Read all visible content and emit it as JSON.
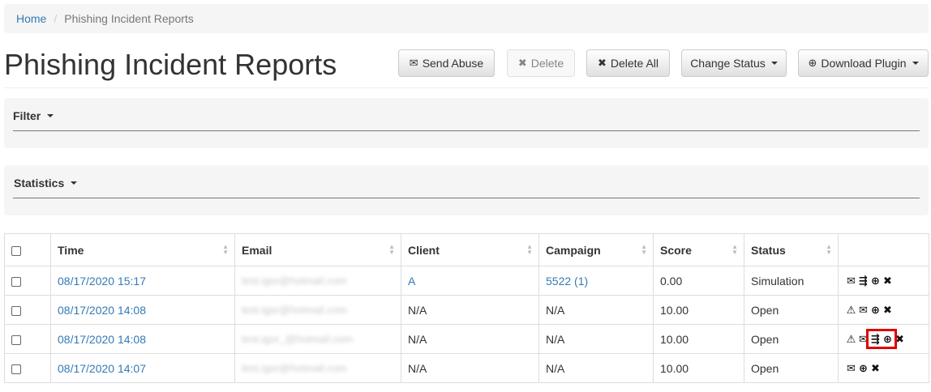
{
  "breadcrumb": {
    "home": "Home",
    "separator": "/",
    "current": "Phishing Incident Reports"
  },
  "page_title": "Phishing Incident Reports",
  "toolbar": {
    "send_abuse": "Send Abuse",
    "delete": "Delete",
    "delete_all": "Delete All",
    "change_status": "Change Status",
    "download_plugin": "Download Plugin"
  },
  "filter_label": "Filter",
  "statistics_label": "Statistics",
  "table": {
    "headers": [
      "Time",
      "Email",
      "Client",
      "Campaign",
      "Score",
      "Status"
    ],
    "rows": [
      {
        "time": "08/17/2020 15:17",
        "email": "test.igor@hotmail.com",
        "client": "A",
        "campaign": "5522 (1)",
        "score": "0.00",
        "status": "Simulation"
      },
      {
        "time": "08/17/2020 14:08",
        "email": "test.igor@hotmail.com",
        "client": "N/A",
        "campaign": "N/A",
        "score": "10.00",
        "status": "Open"
      },
      {
        "time": "08/17/2020 14:08",
        "email": "test.igor_@hotmail.com",
        "client": "N/A",
        "campaign": "N/A",
        "score": "10.00",
        "status": "Open"
      },
      {
        "time": "08/17/2020 14:07",
        "email": "test.igor@hotmail.com",
        "client": "N/A",
        "campaign": "N/A",
        "score": "10.00",
        "status": "Open"
      }
    ]
  },
  "icons": {
    "envelope": "✉",
    "times": "✖",
    "download": "⊕",
    "warning": "⚠",
    "close": "✖",
    "transfer": "⇶"
  },
  "colors": {
    "link": "#337ab7",
    "highlight": "#e00000"
  }
}
